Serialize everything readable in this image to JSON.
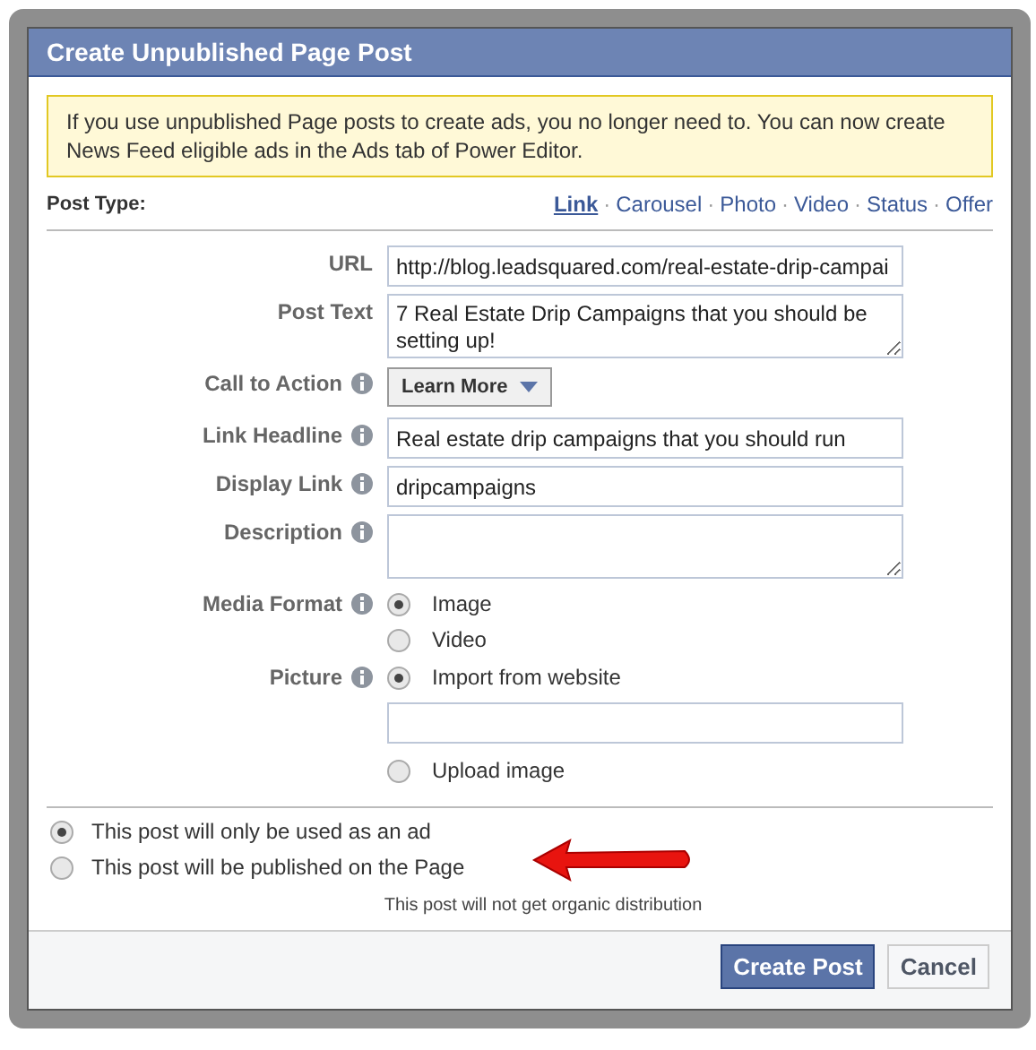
{
  "dialog": {
    "title": "Create Unpublished Page Post"
  },
  "notice": "If you use unpublished Page posts to create ads, you no longer need to. You can now create News Feed eligible ads in the Ads tab of Power Editor.",
  "post_type": {
    "label": "Post Type:",
    "separator": "·",
    "options": [
      {
        "label": "Link",
        "selected": true
      },
      {
        "label": "Carousel",
        "selected": false
      },
      {
        "label": "Photo",
        "selected": false
      },
      {
        "label": "Video",
        "selected": false
      },
      {
        "label": "Status",
        "selected": false
      },
      {
        "label": "Offer",
        "selected": false
      }
    ]
  },
  "rows": [
    {
      "kind": "text",
      "label": "URL",
      "info": false,
      "value": "http://blog.leadsquared.com/real-estate-drip-campai"
    },
    {
      "kind": "textarea",
      "label": "Post Text",
      "info": false,
      "value": "7 Real Estate Drip Campaigns that you should be setting up!"
    },
    {
      "kind": "dropdown",
      "label": "Call to Action",
      "info": true,
      "value": "Learn More"
    },
    {
      "kind": "text",
      "label": "Link Headline",
      "info": true,
      "value": "Real estate drip campaigns that you should run"
    },
    {
      "kind": "text",
      "label": "Display Link",
      "info": true,
      "value": "dripcampaigns"
    },
    {
      "kind": "textarea",
      "label": "Description",
      "info": true
    },
    {
      "kind": "choices",
      "label": "Media Format",
      "info": true,
      "options": [
        {
          "kind": "radio",
          "label": "Image",
          "selected": true
        },
        {
          "kind": "radio",
          "label": "Video",
          "selected": false
        }
      ]
    },
    {
      "kind": "choices",
      "label": "Picture",
      "info": true,
      "options": [
        {
          "kind": "radio",
          "label": "Import from website",
          "selected": true
        },
        {
          "kind": "field"
        },
        {
          "kind": "radio",
          "label": "Upload image",
          "selected": false
        }
      ]
    }
  ],
  "publish_options": [
    {
      "label": "This post will only be used as an ad",
      "selected": true
    },
    {
      "label": "This post will be published on the Page",
      "selected": false
    }
  ],
  "note": "This post will not get organic distribution",
  "buttons": [
    {
      "label": "Create Post",
      "kind": "primary"
    },
    {
      "label": "Cancel",
      "kind": "default"
    }
  ]
}
